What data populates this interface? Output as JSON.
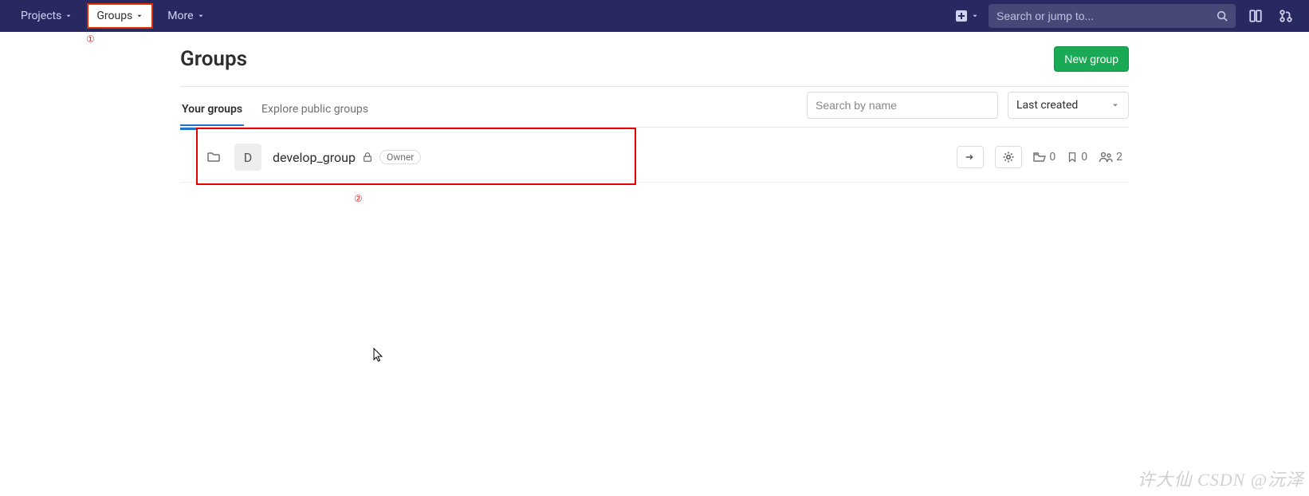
{
  "nav": {
    "projects": "Projects",
    "groups": "Groups",
    "more": "More",
    "search_placeholder": "Search or jump to..."
  },
  "annotations": {
    "one": "①",
    "two": "②"
  },
  "page": {
    "title": "Groups",
    "new_group_btn": "New group"
  },
  "tabs": {
    "your_groups": "Your groups",
    "explore": "Explore public groups"
  },
  "filters": {
    "search_placeholder": "Search by name",
    "sort_selected": "Last created"
  },
  "group_row": {
    "avatar_letter": "D",
    "name": "develop_group",
    "role": "Owner",
    "stats": {
      "subgroups": "0",
      "projects": "0",
      "members": "2"
    }
  },
  "watermark": "许大仙 CSDN @沅泽"
}
